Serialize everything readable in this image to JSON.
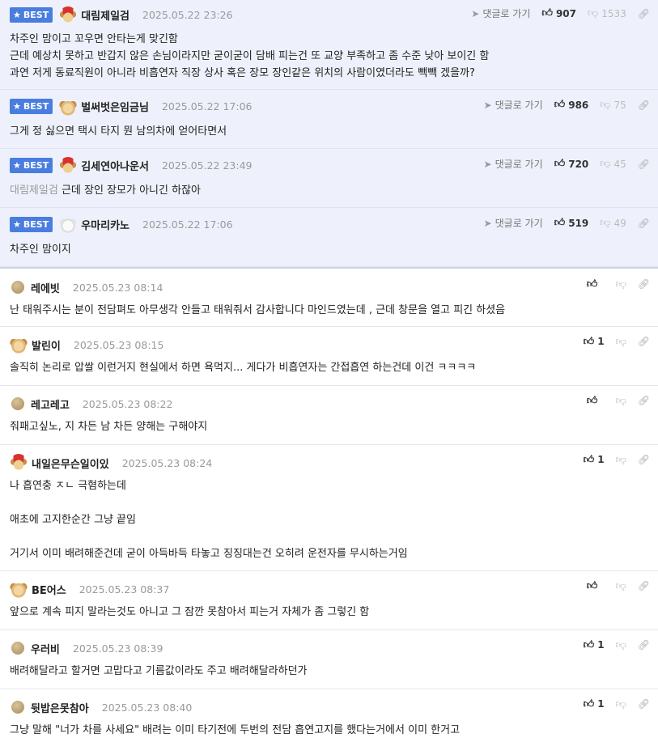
{
  "best_badge": "BEST",
  "reply_label": "댓글로 가기",
  "best": [
    {
      "avatar": "santa",
      "nick": "대림제일검",
      "date": "2025.05.22 23:26",
      "up": "907",
      "down": "1533",
      "lines": [
        "차주인 맘이고 꼬우면 안타는게 맞긴함",
        "근데 예상치 못하고 반갑지 않은 손님이라지만 굳이굳이 담배 피는건 또 교양 부족하고 좀 수준 낮아 보이긴 함",
        "과연 저게 동료직원이 아니라 비흡연자 직장 상사 혹은 장모 장인같은 위치의 사람이였더라도 빽빽 겠을까?"
      ]
    },
    {
      "avatar": "dog",
      "nick": "벌써벗은임금님",
      "date": "2025.05.22 17:06",
      "up": "986",
      "down": "75",
      "lines": [
        "그게 정 싫으면 택시 타지 뭔 남의차에 얻어타면서"
      ]
    },
    {
      "avatar": "santa",
      "nick": "김세연아나운서",
      "date": "2025.05.22 23:49",
      "up": "720",
      "down": "45",
      "mention": "대림제일검",
      "lines": [
        "근데 장인 장모가 아니긴 하잖아"
      ]
    },
    {
      "avatar": "white",
      "nick": "우마리카노",
      "date": "2025.05.22 17:06",
      "up": "519",
      "down": "49",
      "lines": [
        "차주인 맘이지"
      ]
    }
  ],
  "comments": [
    {
      "avatar": "dot",
      "nick": "레에빗",
      "date": "2025.05.23 08:14",
      "up": "",
      "lines": [
        "난 태워주시는 분이 전담펴도 아무생각 안들고 태워줘서 감사합니다 마인드였는데 , 근데 창문을 열고 피긴 하셨음"
      ]
    },
    {
      "avatar": "dog",
      "nick": "발린이",
      "date": "2025.05.23 08:15",
      "up": "1",
      "lines": [
        "솔직히 논리로 압쌀 이런거지 현실에서 하면 욕먹지... 게다가 비흡연자는 간접흡연 하는건데 이건 ㅋㅋㅋㅋ"
      ]
    },
    {
      "avatar": "dot",
      "nick": "레고레고",
      "date": "2025.05.23 08:22",
      "up": "",
      "lines": [
        "줘패고싶노, 지 차든 남 차든 양해는 구해야지"
      ]
    },
    {
      "avatar": "santa",
      "nick": "내일은무슨일이있",
      "date": "2025.05.23 08:24",
      "up": "1",
      "lines": [
        "나 흡연충 ㅈㄴ 극혐하는데",
        "",
        "애초에 고지한순간 그냥 끝임",
        "",
        "거기서 이미 배려해준건데 굳이 아득바득 타놓고 징징대는건 오히려 운전자를 무시하는거임"
      ]
    },
    {
      "avatar": "dog",
      "nick": "BE어스",
      "date": "2025.05.23 08:37",
      "up": "",
      "lines": [
        "앞으로 계속 피지 말라는것도 아니고 그 잠깐 못참아서 피는거 자체가 좀 그렇긴 함"
      ]
    },
    {
      "avatar": "dot",
      "nick": "우러비",
      "date": "2025.05.23 08:39",
      "up": "1",
      "lines": [
        "배려해달라고 할거면 고맙다고 기름값이라도 주고 배려해달라하던가"
      ]
    },
    {
      "avatar": "dot",
      "nick": "뒷밥은못참아",
      "date": "2025.05.23 08:40",
      "up": "1",
      "lines": [
        "그냥 말해 \"너가 차를 사세요\" 배려는 이미 타기전에 두번의 전담 흡연고지를 했다는거에서 이미 한거고"
      ]
    }
  ]
}
